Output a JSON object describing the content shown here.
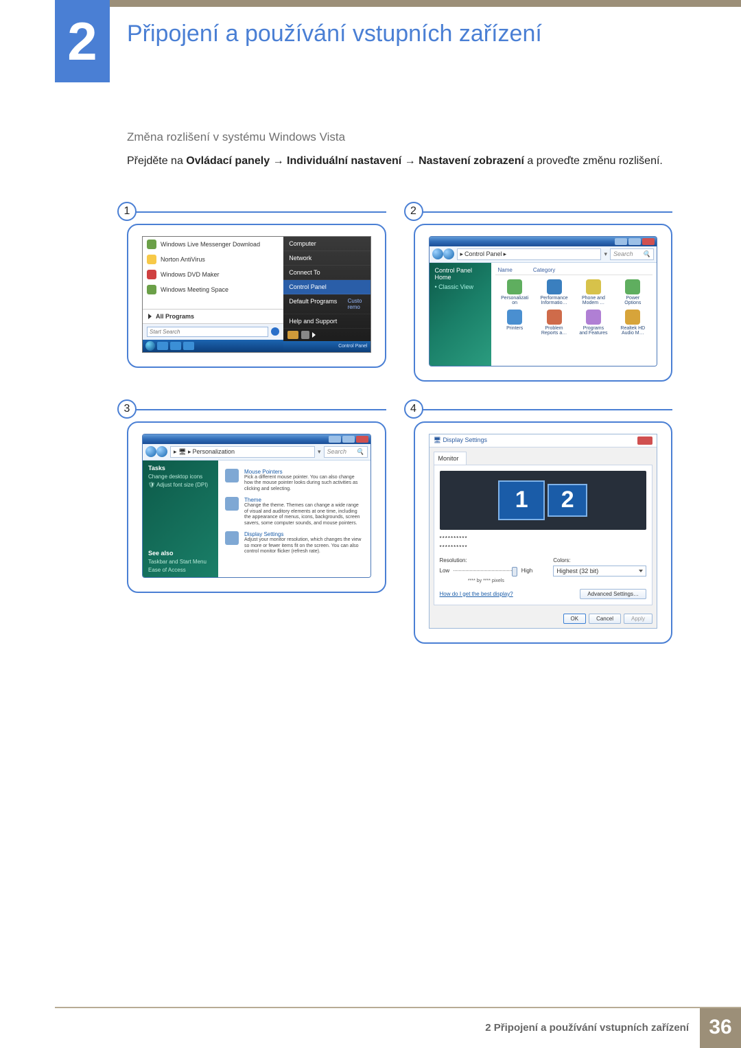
{
  "chapter": {
    "num": "2",
    "title": "Připojení a používání vstupních zařízení"
  },
  "section": {
    "sub": "Změna rozlišení v systému Windows Vista"
  },
  "body": {
    "pre": "Přejděte na ",
    "b1": "Ovládací panely",
    "arr": " → ",
    "b2": "Individuální nastavení",
    "b3": "Nastavení zobrazení",
    "post": " a proveďte změnu rozlišení."
  },
  "steps": [
    "1",
    "2",
    "3",
    "4"
  ],
  "step1": {
    "left_items": [
      "Windows Live Messenger Download",
      "Norton AntiVirus",
      "Windows DVD Maker",
      "Windows Meeting Space"
    ],
    "all_programs": "All Programs",
    "search_placeholder": "Start Search",
    "right_items": [
      "Computer",
      "Network",
      "Connect To",
      "Control Panel",
      "Default Programs",
      "Help and Support"
    ],
    "right_cust": "Custo\nremo",
    "taskbar_label": "Control Panel"
  },
  "step2": {
    "path": "Control Panel",
    "search": "Search",
    "side_home": "Control Panel Home",
    "side_classic": "Classic View",
    "cols": [
      "Name",
      "Category"
    ],
    "icons": [
      {
        "l": "Personalizati\non",
        "c": "#5fae5f"
      },
      {
        "l": "Performance\nInformatio…",
        "c": "#3a7fbf"
      },
      {
        "l": "Phone and\nModem …",
        "c": "#d7c24a"
      },
      {
        "l": "Power\nOptions",
        "c": "#5fae5f"
      },
      {
        "l": "Printers",
        "c": "#4a8fd0"
      },
      {
        "l": "Problem\nReports a…",
        "c": "#cf6b4a"
      },
      {
        "l": "Programs\nand Features",
        "c": "#b07fd4"
      },
      {
        "l": "Realtek HD\nAudio M…",
        "c": "#d7a43a"
      }
    ]
  },
  "step3": {
    "path": "Personalization",
    "search": "Search",
    "side_tasks": "Tasks",
    "side_links1": [
      "Change desktop icons",
      "Adjust font size (DPI)"
    ],
    "side_seealso": "See also",
    "side_links2": [
      "Taskbar and Start Menu",
      "Ease of Access"
    ],
    "entries": [
      {
        "t": "Mouse Pointers",
        "d": "Pick a different mouse pointer. You can also change how the mouse pointer looks during such activities as clicking and selecting."
      },
      {
        "t": "Theme",
        "d": "Change the theme. Themes can change a wide range of visual and auditory elements at one time, including the appearance of menus, icons, backgrounds, screen savers, some computer sounds, and mouse pointers."
      },
      {
        "t": "Display Settings",
        "d": "Adjust your monitor resolution, which changes the view so more or fewer items fit on the screen. You can also control monitor flicker (refresh rate)."
      }
    ]
  },
  "step4": {
    "title": "Display Settings",
    "tab": "Monitor",
    "dots": "**********",
    "res_label": "Resolution:",
    "low": "Low",
    "high": "High",
    "px_note": "**** by **** pixels",
    "colors_label": "Colors:",
    "colors_val": "Highest (32 bit)",
    "link": "How do I get the best display?",
    "adv": "Advanced Settings…",
    "ok": "OK",
    "cancel": "Cancel",
    "apply": "Apply"
  },
  "footer": {
    "text": "2 Připojení a používání vstupních zařízení",
    "num": "36"
  }
}
